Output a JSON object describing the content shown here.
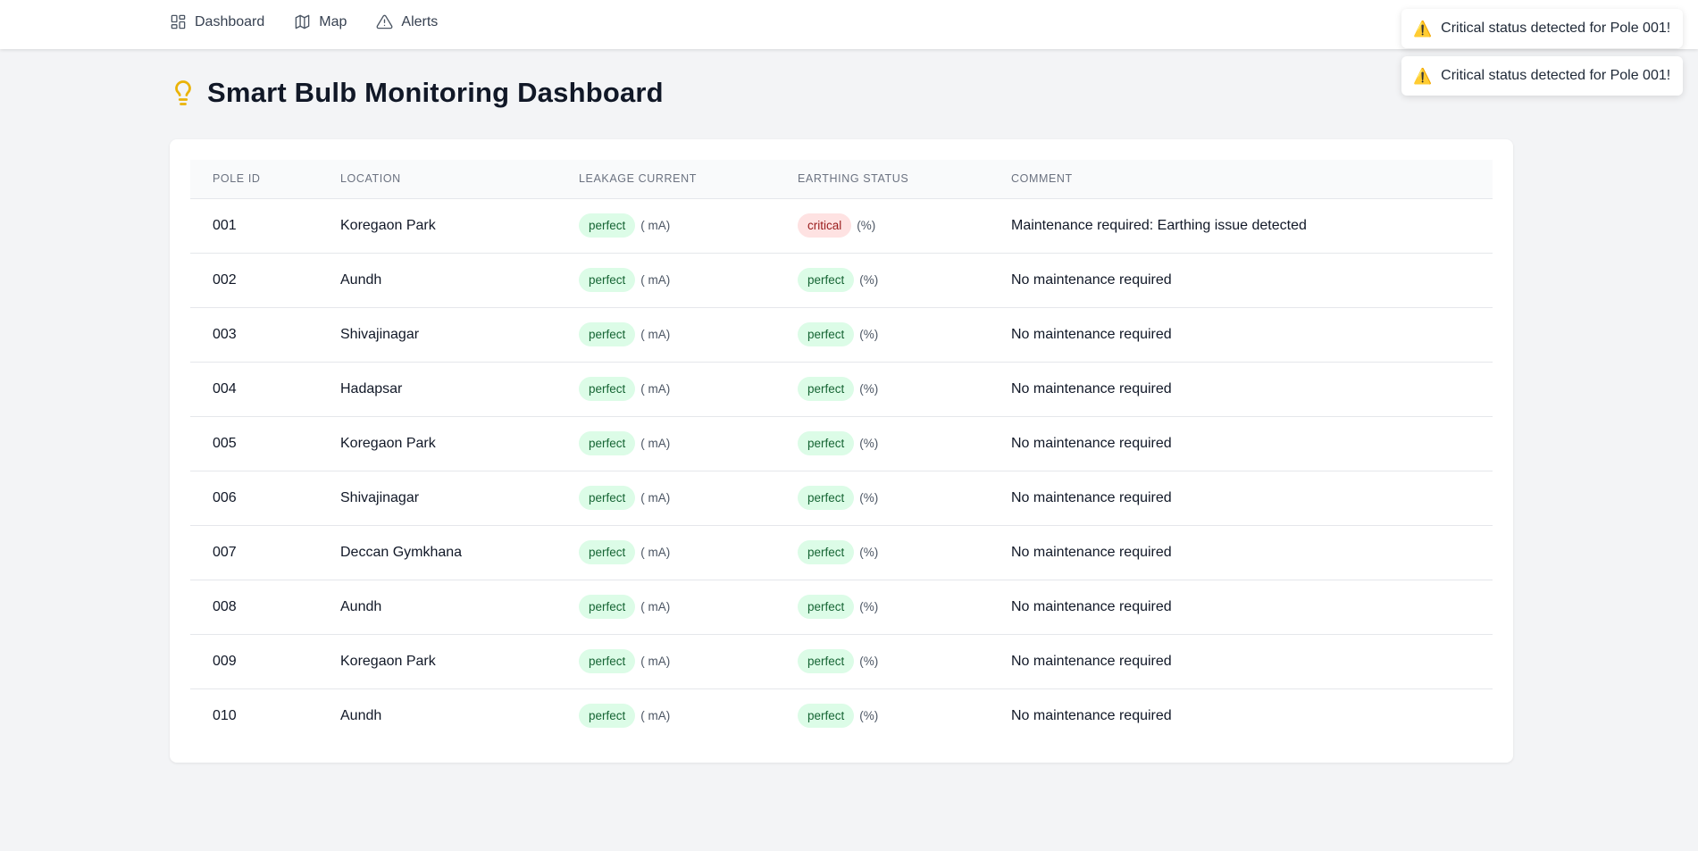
{
  "nav": {
    "items": [
      {
        "label": "Dashboard",
        "icon": "grid-icon"
      },
      {
        "label": "Map",
        "icon": "map-icon"
      },
      {
        "label": "Alerts",
        "icon": "alert-triangle-icon"
      }
    ]
  },
  "toasts": [
    {
      "icon": "⚠️",
      "message": "Critical status detected for Pole 001!"
    },
    {
      "icon": "⚠️",
      "message": "Critical status detected for Pole 001!"
    }
  ],
  "page": {
    "title": "Smart Bulb Monitoring Dashboard",
    "title_icon": "lightbulb-icon"
  },
  "colors": {
    "accent_yellow": "#eab308",
    "ok_bg": "#dcfce7",
    "ok_text": "#166534",
    "critical_bg": "#fee2e2",
    "critical_text": "#991b1b"
  },
  "table": {
    "headers": [
      "Pole ID",
      "Location",
      "Leakage Current",
      "Earthing Status",
      "Comment"
    ],
    "rows": [
      {
        "pole_id": "001",
        "location": "Koregaon Park",
        "leakage_status": "perfect",
        "leakage_unit": "( mA)",
        "earthing_status": "critical",
        "earthing_unit": "(%)",
        "comment": "Maintenance required: Earthing issue detected"
      },
      {
        "pole_id": "002",
        "location": "Aundh",
        "leakage_status": "perfect",
        "leakage_unit": "( mA)",
        "earthing_status": "perfect",
        "earthing_unit": "(%)",
        "comment": "No maintenance required"
      },
      {
        "pole_id": "003",
        "location": "Shivajinagar",
        "leakage_status": "perfect",
        "leakage_unit": "( mA)",
        "earthing_status": "perfect",
        "earthing_unit": "(%)",
        "comment": "No maintenance required"
      },
      {
        "pole_id": "004",
        "location": "Hadapsar",
        "leakage_status": "perfect",
        "leakage_unit": "( mA)",
        "earthing_status": "perfect",
        "earthing_unit": "(%)",
        "comment": "No maintenance required"
      },
      {
        "pole_id": "005",
        "location": "Koregaon Park",
        "leakage_status": "perfect",
        "leakage_unit": "( mA)",
        "earthing_status": "perfect",
        "earthing_unit": "(%)",
        "comment": "No maintenance required"
      },
      {
        "pole_id": "006",
        "location": "Shivajinagar",
        "leakage_status": "perfect",
        "leakage_unit": "( mA)",
        "earthing_status": "perfect",
        "earthing_unit": "(%)",
        "comment": "No maintenance required"
      },
      {
        "pole_id": "007",
        "location": "Deccan Gymkhana",
        "leakage_status": "perfect",
        "leakage_unit": "( mA)",
        "earthing_status": "perfect",
        "earthing_unit": "(%)",
        "comment": "No maintenance required"
      },
      {
        "pole_id": "008",
        "location": "Aundh",
        "leakage_status": "perfect",
        "leakage_unit": "( mA)",
        "earthing_status": "perfect",
        "earthing_unit": "(%)",
        "comment": "No maintenance required"
      },
      {
        "pole_id": "009",
        "location": "Koregaon Park",
        "leakage_status": "perfect",
        "leakage_unit": "( mA)",
        "earthing_status": "perfect",
        "earthing_unit": "(%)",
        "comment": "No maintenance required"
      },
      {
        "pole_id": "010",
        "location": "Aundh",
        "leakage_status": "perfect",
        "leakage_unit": "( mA)",
        "earthing_status": "perfect",
        "earthing_unit": "(%)",
        "comment": "No maintenance required"
      }
    ]
  }
}
